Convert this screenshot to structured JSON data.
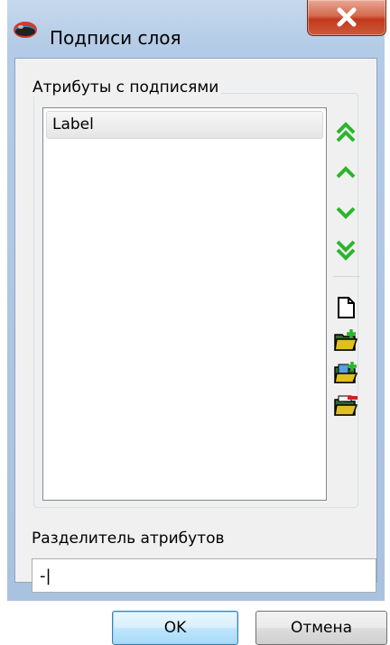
{
  "window": {
    "title": "Подписи слоя",
    "close_symbol": "X"
  },
  "group": {
    "title": "Атрибуты с подписями",
    "items": [
      {
        "label": "Label",
        "selected": true
      }
    ]
  },
  "side_toolbar": {
    "buttons": [
      {
        "name": "move-to-top-icon",
        "color": "#2bb52b"
      },
      {
        "name": "move-up-icon",
        "color": "#2bb52b"
      },
      {
        "name": "move-down-icon",
        "color": "#2bb52b"
      },
      {
        "name": "move-to-bottom-icon",
        "color": "#2bb52b"
      },
      {
        "name": "new-document-icon"
      },
      {
        "name": "open-folder-add-icon"
      },
      {
        "name": "folder-import-icon"
      },
      {
        "name": "folder-remove-icon"
      }
    ]
  },
  "separator": {
    "label": "Разделитель атрибутов",
    "value": "-|"
  },
  "buttons": {
    "ok": "OK",
    "cancel": "Отмена"
  },
  "colors": {
    "accent_green": "#2bb52b",
    "close_red": "#c2391c"
  }
}
